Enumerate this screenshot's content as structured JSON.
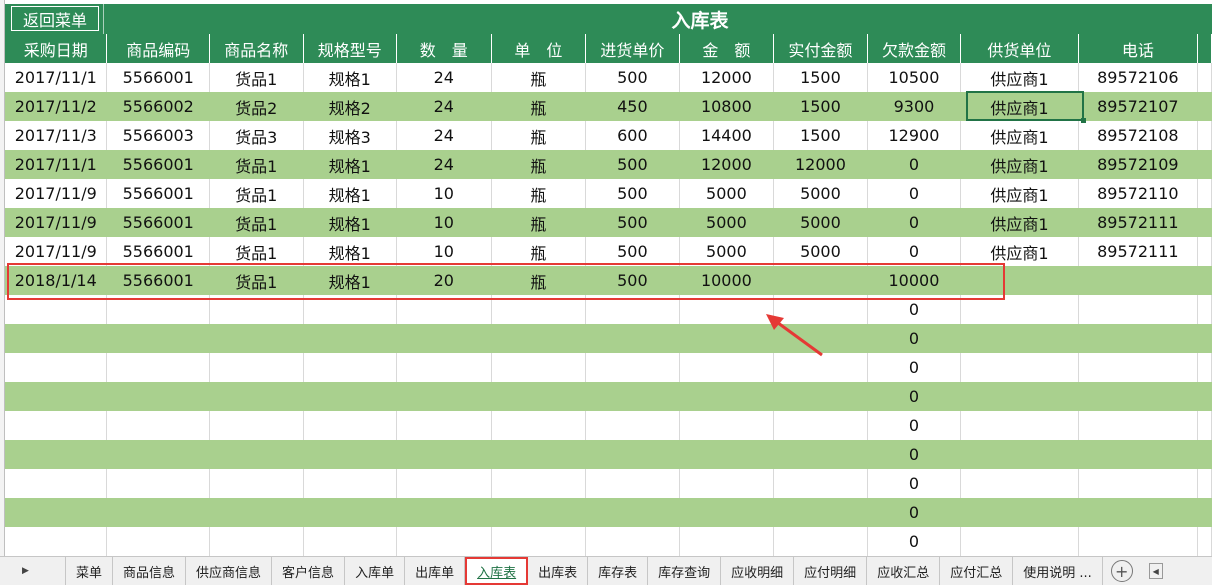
{
  "sheet": {
    "back_button": "返回菜单",
    "title": "入库表",
    "headers": [
      "采购日期",
      "商品编码",
      "商品名称",
      "规格型号",
      "数　量",
      "单　位",
      "进货单价",
      "金　额",
      "实付金额",
      "欠款金额",
      "供货单位",
      "电话"
    ],
    "rows": [
      [
        "2017/11/1",
        "5566001",
        "货品1",
        "规格1",
        "24",
        "瓶",
        "500",
        "12000",
        "1500",
        "10500",
        "供应商1",
        "89572106"
      ],
      [
        "2017/11/2",
        "5566002",
        "货品2",
        "规格2",
        "24",
        "瓶",
        "450",
        "10800",
        "1500",
        "9300",
        "供应商1",
        "89572107"
      ],
      [
        "2017/11/3",
        "5566003",
        "货品3",
        "规格3",
        "24",
        "瓶",
        "600",
        "14400",
        "1500",
        "12900",
        "供应商1",
        "89572108"
      ],
      [
        "2017/11/1",
        "5566001",
        "货品1",
        "规格1",
        "24",
        "瓶",
        "500",
        "12000",
        "12000",
        "0",
        "供应商1",
        "89572109"
      ],
      [
        "2017/11/9",
        "5566001",
        "货品1",
        "规格1",
        "10",
        "瓶",
        "500",
        "5000",
        "5000",
        "0",
        "供应商1",
        "89572110"
      ],
      [
        "2017/11/9",
        "5566001",
        "货品1",
        "规格1",
        "10",
        "瓶",
        "500",
        "5000",
        "5000",
        "0",
        "供应商1",
        "89572111"
      ],
      [
        "2017/11/9",
        "5566001",
        "货品1",
        "规格1",
        "10",
        "瓶",
        "500",
        "5000",
        "5000",
        "0",
        "供应商1",
        "89572111"
      ],
      [
        "2018/1/14",
        "5566001",
        "货品1",
        "规格1",
        "20",
        "瓶",
        "500",
        "10000",
        "",
        "10000",
        "",
        ""
      ],
      [
        "",
        "",
        "",
        "",
        "",
        "",
        "",
        "",
        "",
        "0",
        "",
        ""
      ],
      [
        "",
        "",
        "",
        "",
        "",
        "",
        "",
        "",
        "",
        "0",
        "",
        ""
      ],
      [
        "",
        "",
        "",
        "",
        "",
        "",
        "",
        "",
        "",
        "0",
        "",
        ""
      ],
      [
        "",
        "",
        "",
        "",
        "",
        "",
        "",
        "",
        "",
        "0",
        "",
        ""
      ],
      [
        "",
        "",
        "",
        "",
        "",
        "",
        "",
        "",
        "",
        "0",
        "",
        ""
      ],
      [
        "",
        "",
        "",
        "",
        "",
        "",
        "",
        "",
        "",
        "0",
        "",
        ""
      ],
      [
        "",
        "",
        "",
        "",
        "",
        "",
        "",
        "",
        "",
        "0",
        "",
        ""
      ],
      [
        "",
        "",
        "",
        "",
        "",
        "",
        "",
        "",
        "",
        "0",
        "",
        ""
      ],
      [
        "",
        "",
        "",
        "",
        "",
        "",
        "",
        "",
        "",
        "0",
        "",
        ""
      ]
    ]
  },
  "tabs": {
    "items": [
      "菜单",
      "商品信息",
      "供应商信息",
      "客户信息",
      "入库单",
      "出库单",
      "入库表",
      "出库表",
      "库存表",
      "库存查询",
      "应收明细",
      "应付明细",
      "应收汇总",
      "应付汇总",
      "使用说明 ..."
    ],
    "active_index": 6,
    "nav_arrow_icon": "triangle-right-icon",
    "add_icon": "plus-circle-icon"
  },
  "colors": {
    "header_green": "#2e8b57",
    "band_green": "#a9d08e",
    "highlight_red": "#e53935",
    "selection_green": "#217346"
  }
}
